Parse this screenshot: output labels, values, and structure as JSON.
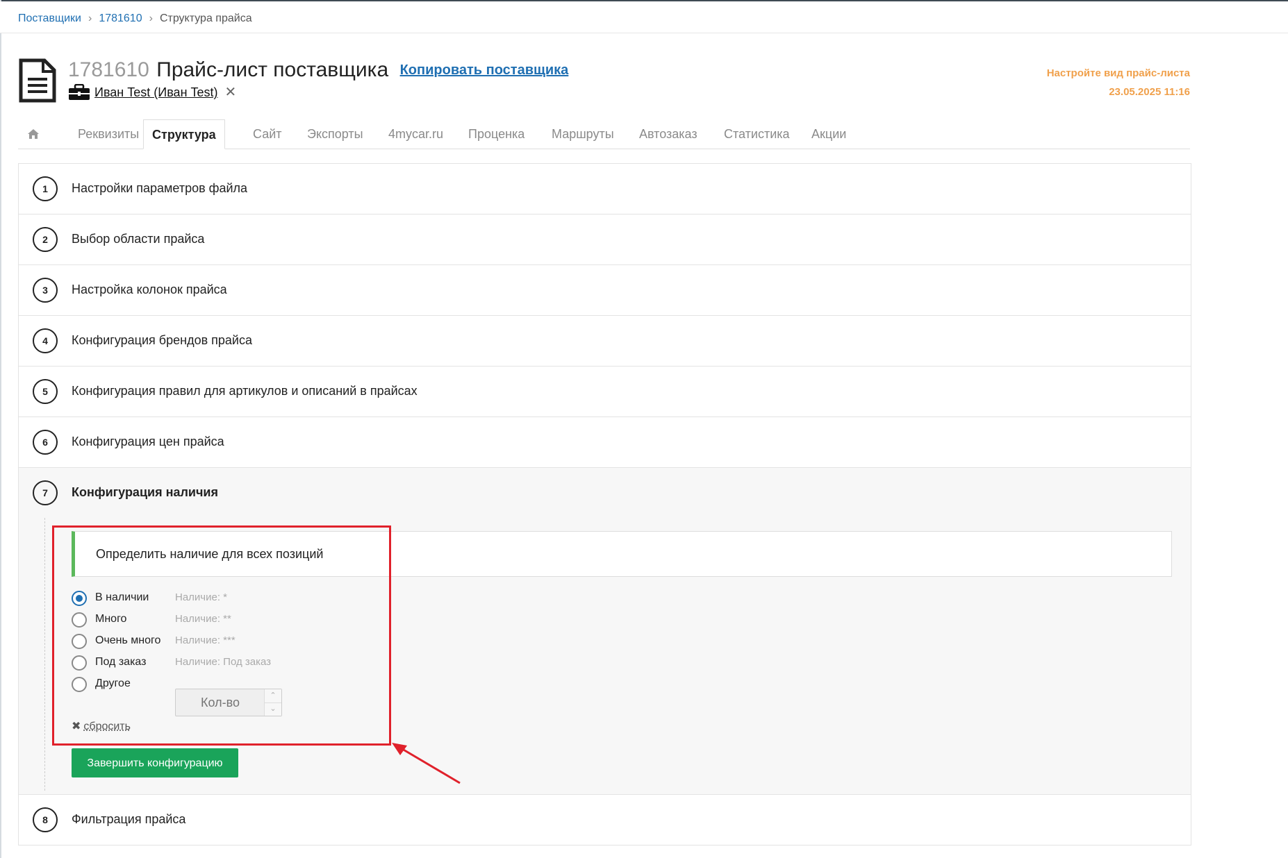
{
  "breadcrumb": {
    "suppliers": "Поставщики",
    "supplier_id": "1781610",
    "current": "Структура прайса"
  },
  "header": {
    "id": "1781610",
    "title": "Прайс-лист поставщика",
    "copy_link": "Копировать поставщика",
    "user": "Иван Test (Иван Test)",
    "remove_symbol": "✕"
  },
  "notice": {
    "line1": "Настройте вид прайс-листа",
    "line2": "23.05.2025 11:16"
  },
  "tabs": [
    {
      "label": "Реквизиты"
    },
    {
      "label": "Структура"
    },
    {
      "label": "Сайт"
    },
    {
      "label": "Экспорты"
    },
    {
      "label": "4mycar.ru"
    },
    {
      "label": "Проценка"
    },
    {
      "label": "Маршруты"
    },
    {
      "label": "Автозаказ"
    },
    {
      "label": "Статистика"
    },
    {
      "label": "Акции"
    }
  ],
  "steps": [
    {
      "num": "1",
      "label": "Настройки параметров файла"
    },
    {
      "num": "2",
      "label": "Выбор области прайса"
    },
    {
      "num": "3",
      "label": "Настройка колонок прайса"
    },
    {
      "num": "4",
      "label": "Конфигурация брендов прайса"
    },
    {
      "num": "5",
      "label": "Конфигурация правил для артикулов и описаний в прайсах"
    },
    {
      "num": "6",
      "label": "Конфигурация цен прайса"
    },
    {
      "num": "7",
      "label": "Конфигурация наличия"
    },
    {
      "num": "8",
      "label": "Фильтрация прайса"
    }
  ],
  "availability": {
    "info": "Определить наличие для всех позиций",
    "options": [
      {
        "label": "В наличии",
        "hint": "Наличие: *",
        "checked": true
      },
      {
        "label": "Много",
        "hint": "Наличие: **",
        "checked": false
      },
      {
        "label": "Очень много",
        "hint": "Наличие: ***",
        "checked": false
      },
      {
        "label": "Под заказ",
        "hint": "Наличие: Под заказ",
        "checked": false
      },
      {
        "label": "Другое",
        "hint": "",
        "checked": false
      }
    ],
    "qty_placeholder": "Кол-во",
    "reset_symbol": "✖",
    "reset_label": "сбросить",
    "finish_button": "Завершить конфигурацию"
  },
  "icons": {
    "page": "document-icon",
    "user": "briefcase-icon",
    "home": "home-icon"
  },
  "colors": {
    "link": "#1f6fb2",
    "notice": "#f0a04b",
    "success": "#1aa45a",
    "annotation": "#e0212b",
    "info_border": "#5cb85c"
  }
}
